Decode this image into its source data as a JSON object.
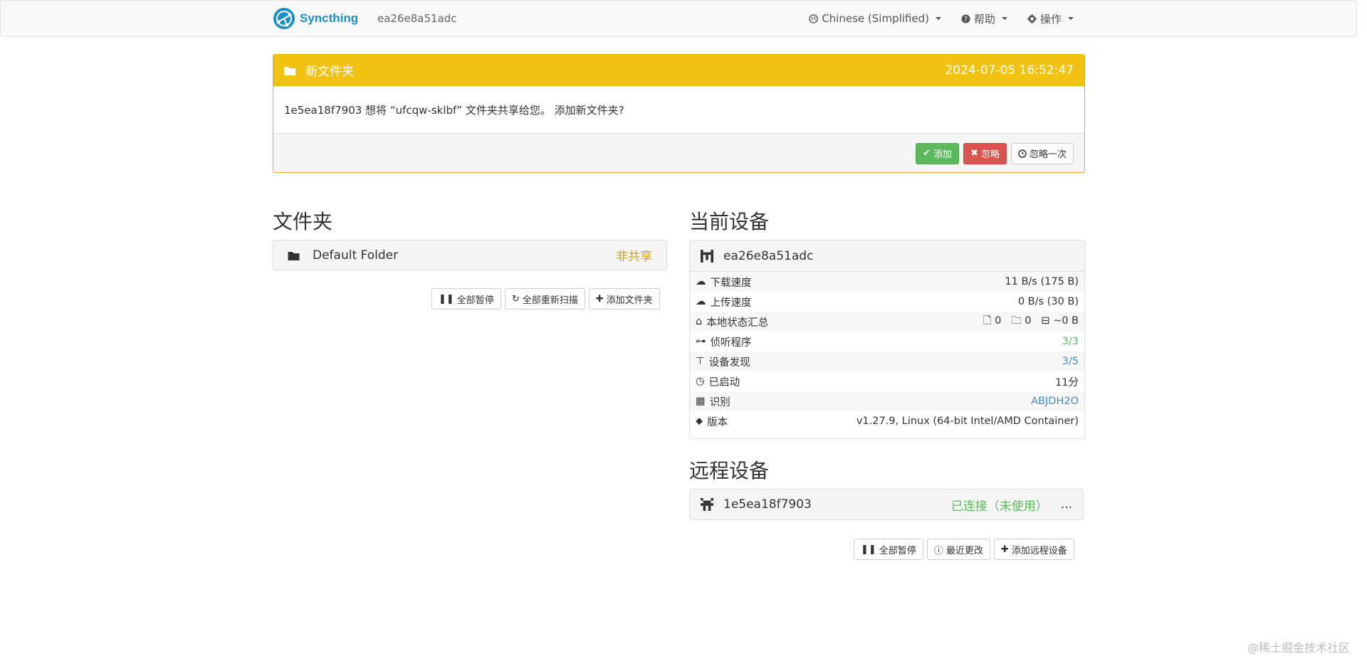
{
  "navbar": {
    "brand": "Syncthing",
    "device_id": "ea26e8a51adc",
    "language": "Chinese (Simplified)",
    "help": "帮助",
    "actions": "操作"
  },
  "notice": {
    "title": "新文件夹",
    "time": "2024-07-05 16:52:47",
    "message": "1e5ea18f7903 想将 “ufcqw-sklbf” 文件夹共享给您。 添加新文件夹?",
    "add": "添加",
    "ignore": "忽略",
    "dismiss": "忽略一次"
  },
  "folders": {
    "heading": "文件夹",
    "items": [
      {
        "name": "Default Folder",
        "state": "非共享"
      }
    ],
    "buttons": {
      "pause_all": "全部暂停",
      "rescan_all": "全部重新扫描",
      "add_folder": "添加文件夹"
    }
  },
  "this_device": {
    "heading": "当前设备",
    "name": "ea26e8a51adc",
    "rows": [
      {
        "label": "下载速度",
        "value": "11 B/s (175 B)"
      },
      {
        "label": "上传速度",
        "value": "0 B/s (30 B)"
      },
      {
        "label": "本地状态汇总",
        "files": "0",
        "dirs": "0",
        "size": "~0 B"
      },
      {
        "label": "侦听程序",
        "value": "3/3"
      },
      {
        "label": "设备发现",
        "value": "3/5"
      },
      {
        "label": "已启动",
        "value": "11分"
      },
      {
        "label": "识别",
        "value": "ABJDH2O"
      },
      {
        "label": "版本",
        "value": "v1.27.9, Linux (64-bit Intel/AMD Container)"
      }
    ]
  },
  "remote_devices": {
    "heading": "远程设备",
    "items": [
      {
        "name": "1e5ea18f7903",
        "status": "已连接（未使用）",
        "more": "..."
      }
    ],
    "buttons": {
      "pause_all": "全部暂停",
      "recent_changes": "最近更改",
      "add_remote": "添加远程设备"
    }
  },
  "watermark": "@稀土掘金技术社区",
  "colors": {
    "brand": "#1b8fc6",
    "warning": "#f2c212",
    "success": "#5cb85c",
    "danger": "#d9534f",
    "info": "#428bca",
    "folder_state": "#d4a017"
  }
}
